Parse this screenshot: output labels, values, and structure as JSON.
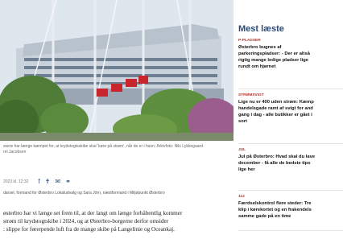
{
  "article": {
    "photo_alt": "",
    "caption": "ssere har længe kæmpet for, at krydstogtsskibe skal ’køre på strøm’, når de er i havn. Arkivfoto: Nils Lykkegaard",
    "caption_line2": "rel Jacobsen",
    "date": "2023 kl. 12:32",
    "share_icons": [
      "facebook-icon",
      "twitter-icon",
      "email-icon",
      "link-icon"
    ],
    "authors": "darsel, formand for Østerbro Lokaludvalg og Sara Jörn, næstformand i Miljøpunkt Østerbro",
    "body": [
      "østerbro har vi længe set frem til, at der langt om længe forhåbentlig kommer",
      "strøm til krydstogtskibe i 2024, og at Østerbro-borgerne derfor omsider",
      ": slippe for førerpende luft fra de mange skibe på Langelinie og Oceankaj."
    ]
  },
  "sidebar": {
    "title": "Mest læste",
    "items": [
      {
        "category": "P-PLADSER",
        "headline": [
          "Østerbro bugnes af",
          "parkeringspladser: - Der er altså",
          "rigtig mange ledige pladser lige",
          "rundt om hjørnet"
        ]
      },
      {
        "category": "STRØMSVIGT",
        "headline": [
          "Lige nu er 400 uden strøm: Kæmp",
          "handelsgade ramt af svigt for and",
          "gang i dag - alle butikker er gået i",
          "sort"
        ]
      },
      {
        "category": "JUL",
        "headline": [
          "Jul på Østerbro: Hvad skal du lave",
          "december - få alle de bedste tips",
          "lige her"
        ]
      },
      {
        "category": "112",
        "headline": [
          "Færdselskontrol flere steder: Tre",
          "klip i kørekortet og en frakendels",
          "samme gade på en time"
        ]
      }
    ]
  },
  "colors": {
    "accent": "#2b4a7a",
    "category": "#b0352c"
  }
}
